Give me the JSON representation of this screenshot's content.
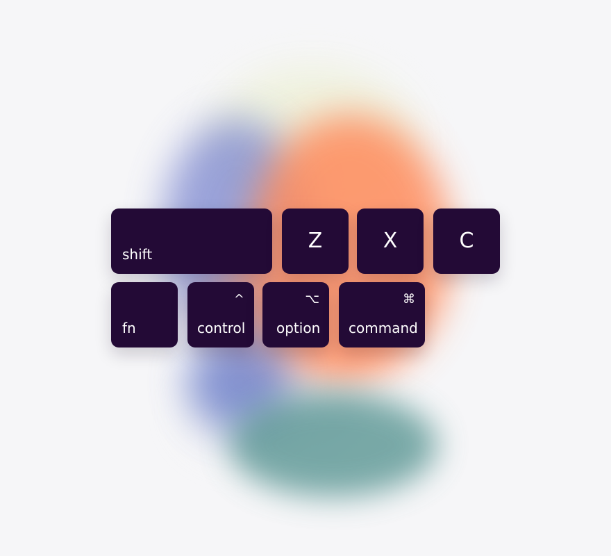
{
  "keys": {
    "shift": {
      "label": "shift"
    },
    "z": {
      "label": "Z"
    },
    "x": {
      "label": "X"
    },
    "c": {
      "label": "C"
    },
    "fn": {
      "label": "fn"
    },
    "control": {
      "symbol": "^",
      "label": "control"
    },
    "option": {
      "symbol": "⌥",
      "label": "option"
    },
    "command": {
      "symbol": "⌘",
      "label": "command"
    }
  },
  "colors": {
    "key_background": "#230a36",
    "key_text": "#ffffff",
    "page_background": "#f6f6f8",
    "accent_orange": "#ff8b5c",
    "accent_blue": "#7b86cf",
    "accent_teal": "#4f8f8c"
  }
}
